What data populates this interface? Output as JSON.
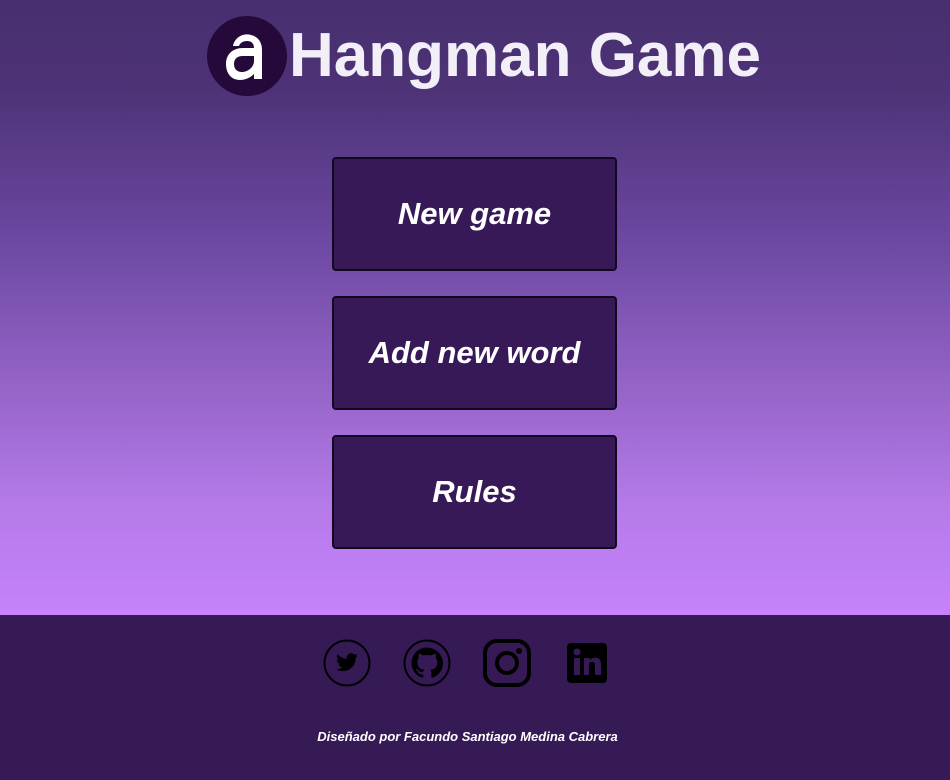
{
  "header": {
    "title": "Hangman Game",
    "logo_icon": "alura-logo-icon"
  },
  "menu": {
    "new_game": "New game",
    "add_word": "Add new word",
    "rules": "Rules"
  },
  "footer": {
    "social": [
      {
        "icon": "twitter-icon"
      },
      {
        "icon": "github-icon"
      },
      {
        "icon": "instagram-icon"
      },
      {
        "icon": "linkedin-icon"
      }
    ],
    "credit": "Diseñado por Facundo Santiago Medina Cabrera"
  },
  "colors": {
    "gradient_top": "#47306f",
    "gradient_bottom": "#c682fb",
    "button_bg": "#371958",
    "footer_bg": "#361a56",
    "logo_bg": "#25093a"
  }
}
